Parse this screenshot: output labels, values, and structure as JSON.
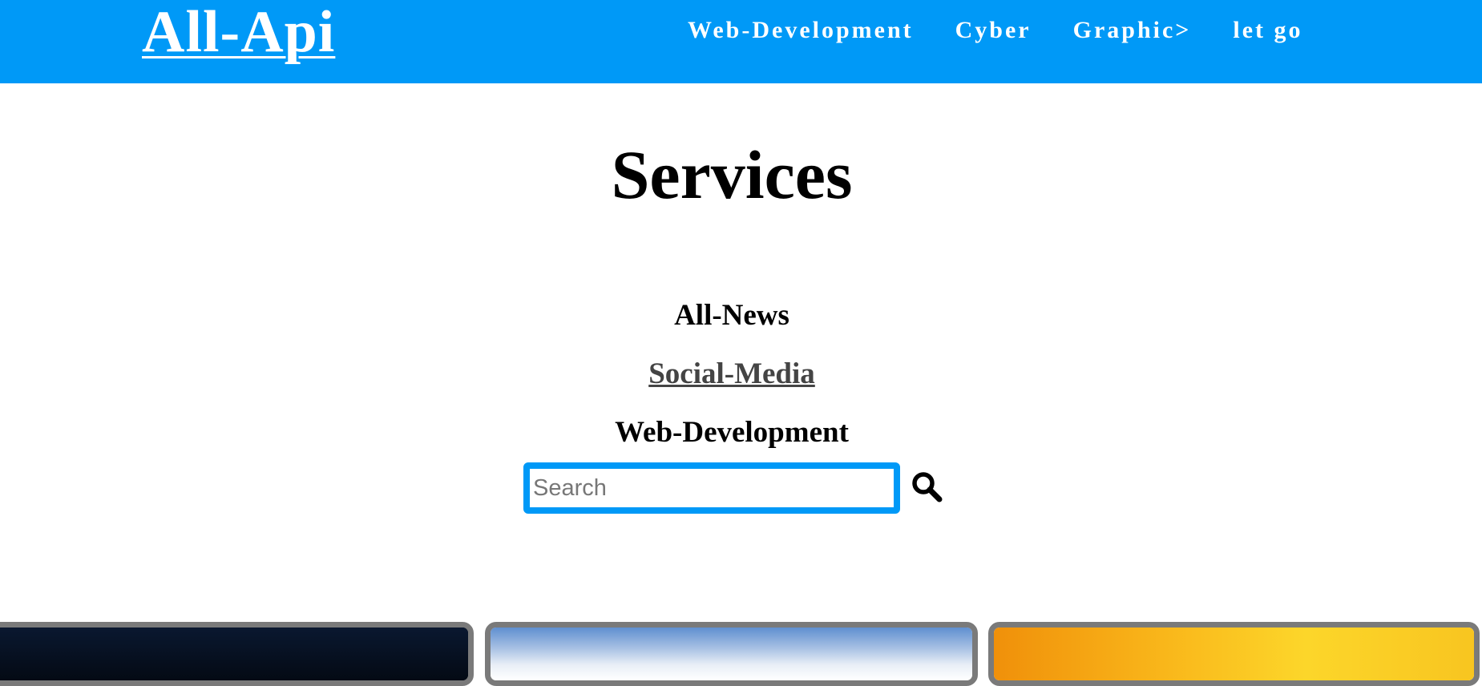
{
  "header": {
    "logo": "All-Api",
    "nav": [
      {
        "label": "Web-Development"
      },
      {
        "label": "Cyber"
      },
      {
        "label": "Graphic>"
      },
      {
        "label": "let go"
      }
    ]
  },
  "main": {
    "title": "Services",
    "services": [
      {
        "label": "All-News"
      },
      {
        "label": "Social-Media"
      },
      {
        "label": "Web-Development"
      }
    ],
    "search": {
      "placeholder": "Search",
      "value": "",
      "icon": "search-icon"
    }
  },
  "colors": {
    "header_bg": "#0099f7",
    "search_border": "#0099f7",
    "card_border": "#7a7a7a"
  }
}
